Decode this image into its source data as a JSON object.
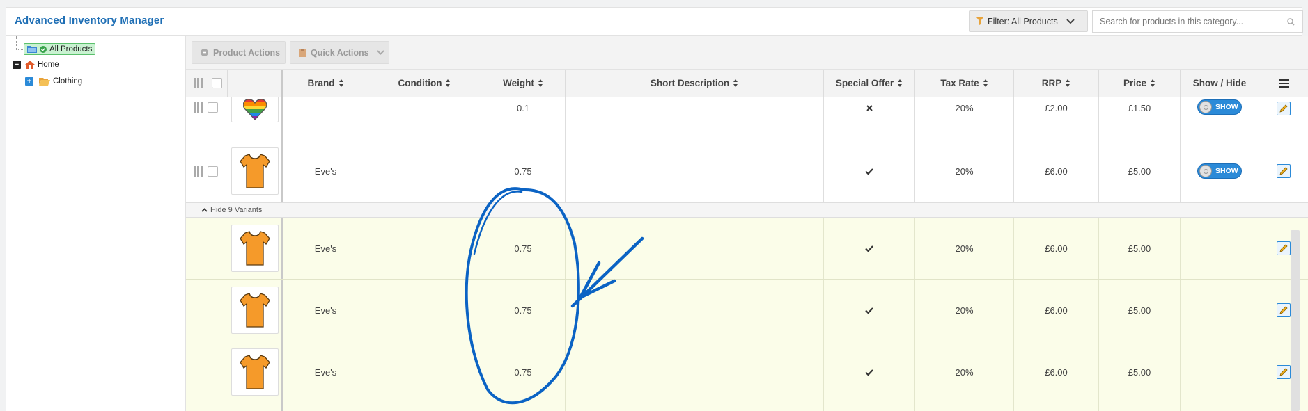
{
  "app": {
    "title": "Advanced Inventory Manager"
  },
  "header": {
    "filter_label": "Filter: All Products",
    "search_placeholder": "Search for products in this category..."
  },
  "sidebar": {
    "items": [
      {
        "label": "All Products"
      },
      {
        "label": "Home"
      },
      {
        "label": "Clothing"
      }
    ]
  },
  "toolbar": {
    "product_actions": "Product Actions",
    "quick_actions": "Quick Actions"
  },
  "table": {
    "columns": [
      "Brand",
      "Condition",
      "Weight",
      "Short Description",
      "Special Offer",
      "Tax Rate",
      "RRP",
      "Price",
      "Show / Hide"
    ],
    "rows": [
      {
        "brand": "",
        "condition": "",
        "weight": "0.1",
        "description": "",
        "special_offer": "cross",
        "tax": "20%",
        "rrp": "£2.00",
        "price": "£1.50",
        "toggle": "SHOW",
        "image": "rainbow-heart"
      },
      {
        "brand": "Eve's",
        "condition": "",
        "weight": "0.75",
        "description": "",
        "special_offer": "check",
        "tax": "20%",
        "rrp": "£6.00",
        "price": "£5.00",
        "toggle": "SHOW",
        "image": "orange-tshirt"
      }
    ],
    "variants_toggle": "Hide 9 Variants",
    "variants": [
      {
        "brand": "Eve's",
        "condition": "",
        "weight": "0.75",
        "description": "",
        "special_offer": "check",
        "tax": "20%",
        "rrp": "£6.00",
        "price": "£5.00",
        "image": "orange-tshirt"
      },
      {
        "brand": "Eve's",
        "condition": "",
        "weight": "0.75",
        "description": "",
        "special_offer": "check",
        "tax": "20%",
        "rrp": "£6.00",
        "price": "£5.00",
        "image": "orange-tshirt"
      },
      {
        "brand": "Eve's",
        "condition": "",
        "weight": "0.75",
        "description": "",
        "special_offer": "check",
        "tax": "20%",
        "rrp": "£6.00",
        "price": "£5.00",
        "image": "orange-tshirt"
      }
    ]
  },
  "colors": {
    "accent": "#1f6fb5",
    "toggle": "#2b8ad8",
    "annotation": "#0b63c4",
    "variant_bg": "#fbfde9"
  }
}
